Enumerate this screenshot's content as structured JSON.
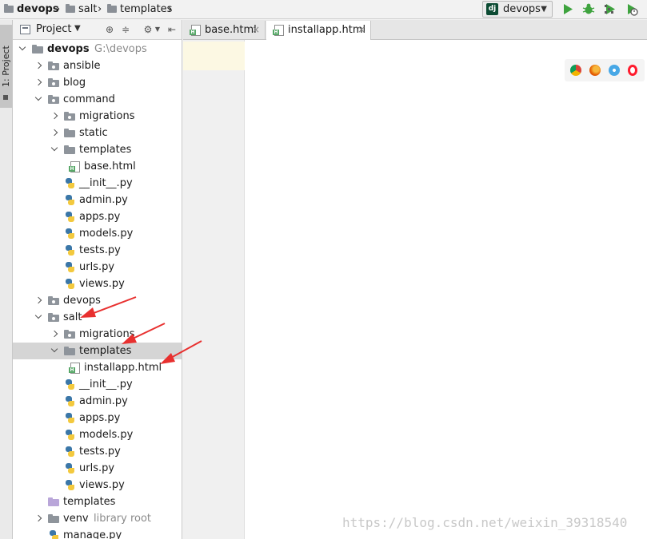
{
  "breadcrumb": [
    "devops",
    "salt",
    "templates"
  ],
  "run_config": {
    "label": "devops",
    "logo_text": "dj"
  },
  "project_panel": {
    "title": "Project",
    "tool_tab": "1: Project"
  },
  "tree": [
    {
      "label": "devops",
      "hint": "G:\\devops",
      "level": 0,
      "type": "folder",
      "state": "open",
      "bold": true
    },
    {
      "label": "ansible",
      "level": 1,
      "type": "pkg",
      "state": "closed"
    },
    {
      "label": "blog",
      "level": 1,
      "type": "pkg",
      "state": "closed"
    },
    {
      "label": "command",
      "level": 1,
      "type": "pkg",
      "state": "open"
    },
    {
      "label": "migrations",
      "level": 2,
      "type": "pkg",
      "state": "closed"
    },
    {
      "label": "static",
      "level": 2,
      "type": "folder",
      "state": "closed"
    },
    {
      "label": "templates",
      "level": 2,
      "type": "folder",
      "state": "open"
    },
    {
      "label": "base.html",
      "level": 3,
      "type": "html"
    },
    {
      "label": "__init__.py",
      "level": 2,
      "type": "py"
    },
    {
      "label": "admin.py",
      "level": 2,
      "type": "py"
    },
    {
      "label": "apps.py",
      "level": 2,
      "type": "py"
    },
    {
      "label": "models.py",
      "level": 2,
      "type": "py"
    },
    {
      "label": "tests.py",
      "level": 2,
      "type": "py"
    },
    {
      "label": "urls.py",
      "level": 2,
      "type": "py"
    },
    {
      "label": "views.py",
      "level": 2,
      "type": "py"
    },
    {
      "label": "devops",
      "level": 1,
      "type": "pkg",
      "state": "closed"
    },
    {
      "label": "salt",
      "level": 1,
      "type": "pkg",
      "state": "open"
    },
    {
      "label": "migrations",
      "level": 2,
      "type": "pkg",
      "state": "closed"
    },
    {
      "label": "templates",
      "level": 2,
      "type": "folder",
      "state": "open",
      "selected": true
    },
    {
      "label": "installapp.html",
      "level": 3,
      "type": "html"
    },
    {
      "label": "__init__.py",
      "level": 2,
      "type": "py"
    },
    {
      "label": "admin.py",
      "level": 2,
      "type": "py"
    },
    {
      "label": "apps.py",
      "level": 2,
      "type": "py"
    },
    {
      "label": "models.py",
      "level": 2,
      "type": "py"
    },
    {
      "label": "tests.py",
      "level": 2,
      "type": "py"
    },
    {
      "label": "urls.py",
      "level": 2,
      "type": "py"
    },
    {
      "label": "views.py",
      "level": 2,
      "type": "py"
    },
    {
      "label": "templates",
      "level": 1,
      "type": "tpl"
    },
    {
      "label": "venv",
      "hint": "library root",
      "level": 1,
      "type": "folder",
      "state": "closed"
    },
    {
      "label": "manage.py",
      "level": 1,
      "type": "py"
    }
  ],
  "editor_tabs": [
    {
      "label": "base.html",
      "active": false
    },
    {
      "label": "installapp.html",
      "active": true
    }
  ],
  "browser_icons": [
    "chrome-icon",
    "firefox-icon",
    "safari-icon",
    "opera-icon"
  ],
  "watermark": "https://blog.csdn.net/weixin_39318540",
  "colors": {
    "annotation_arrow": "#e8302f",
    "selection": "#d5d5d5",
    "current_line": "#fcf8e3"
  }
}
